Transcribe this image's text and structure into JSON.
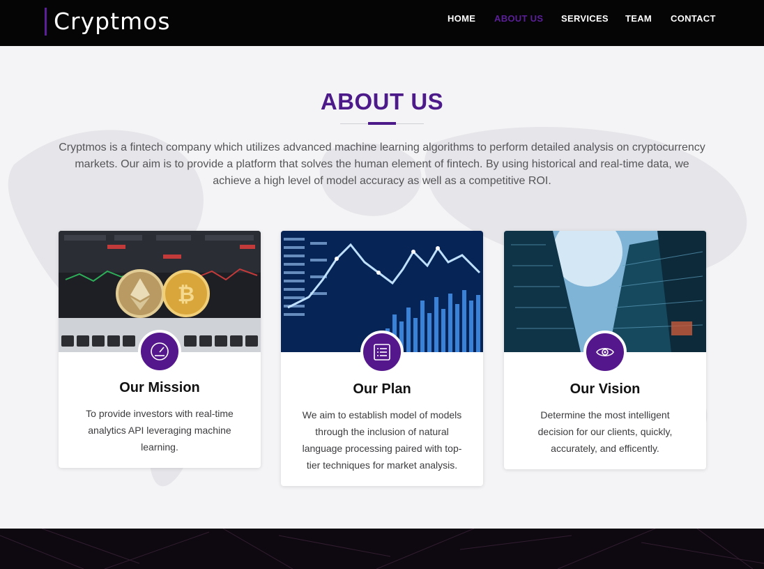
{
  "header": {
    "brand": "Cryptmos",
    "nav": [
      {
        "label": "HOME",
        "active": false
      },
      {
        "label": "ABOUT US",
        "active": true
      },
      {
        "label": "SERVICES",
        "active": false
      },
      {
        "label": "TEAM",
        "active": false
      },
      {
        "label": "CONTACT",
        "active": false
      }
    ]
  },
  "about": {
    "title": "ABOUT US",
    "intro": "Cryptmos is a fintech company which utilizes advanced machine learning algorithms to perform detailed analysis on cryptocurrency markets. Our aim is to provide a platform that solves the human element of fintech. By using historical and real-time data, we achieve a high level of model accuracy as well as a competitive ROI."
  },
  "cards": [
    {
      "icon": "speedometer-icon",
      "image": "crypto-coins-image",
      "title": "Our Mission",
      "text": "To provide investors with real-time analytics API leveraging machine learning."
    },
    {
      "icon": "list-icon",
      "image": "stock-chart-image",
      "title": "Our Plan",
      "text": "We aim to establish model of models through the inclusion of natural language processing paired with top-tier techniques for market analysis."
    },
    {
      "icon": "eye-icon",
      "image": "skyscraper-image",
      "title": "Our Vision",
      "text": "Determine the most intelligent decision for our clients, quickly, accurately, and efficently."
    }
  ],
  "colors": {
    "accent": "#4d1a8a",
    "icon_bg": "#54178c",
    "header_bg": "#050505",
    "footer_bg": "#0e0810"
  }
}
